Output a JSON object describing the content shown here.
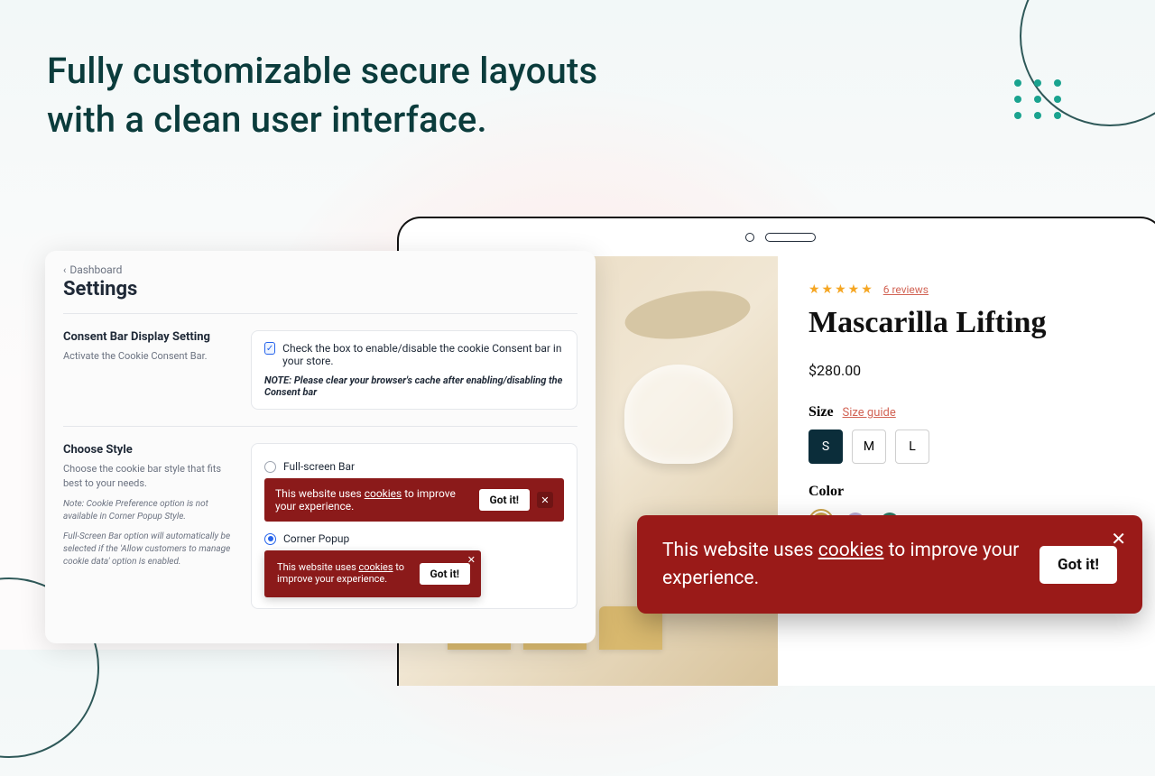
{
  "hero": {
    "line1": "Fully customizable secure layouts",
    "line2": "with a clean user interface."
  },
  "settings": {
    "breadcrumb": "Dashboard",
    "title": "Settings",
    "section1": {
      "heading": "Consent Bar Display Setting",
      "desc": "Activate the Cookie Consent Bar.",
      "checkbox_label": "Check the box to enable/disable the cookie Consent bar in your store.",
      "note": "NOTE: Please clear your browser's cache after enabling/disabling the Consent bar"
    },
    "section2": {
      "heading": "Choose Style",
      "desc": "Choose the cookie bar style that fits best to your needs.",
      "note1": "Note: Cookie Preference option is not available in Corner Popup Style.",
      "note2": "Full-Screen Bar option will automatically be selected if the 'Allow customers to manage cookie data' option is enabled.",
      "option1": "Full-screen Bar",
      "option2": "Corner Popup",
      "sample_prefix": "This website uses ",
      "sample_cookies": "cookies",
      "sample_suffix": " to improve your experience.",
      "gotit": "Got it!"
    }
  },
  "product": {
    "reviews_count": "6 reviews",
    "title": "Mascarilla Lifting",
    "price": "$280.00",
    "size_label": "Size",
    "size_guide": "Size guide",
    "sizes": [
      "S",
      "M",
      "L"
    ],
    "color_label": "Color",
    "swatches": [
      "#caa24a",
      "#b7a9d4",
      "#2f7a65"
    ]
  },
  "live_popup": {
    "prefix": "This website uses ",
    "cookies": "cookies",
    "suffix": " to improve your experience.",
    "button": "Got it!"
  }
}
